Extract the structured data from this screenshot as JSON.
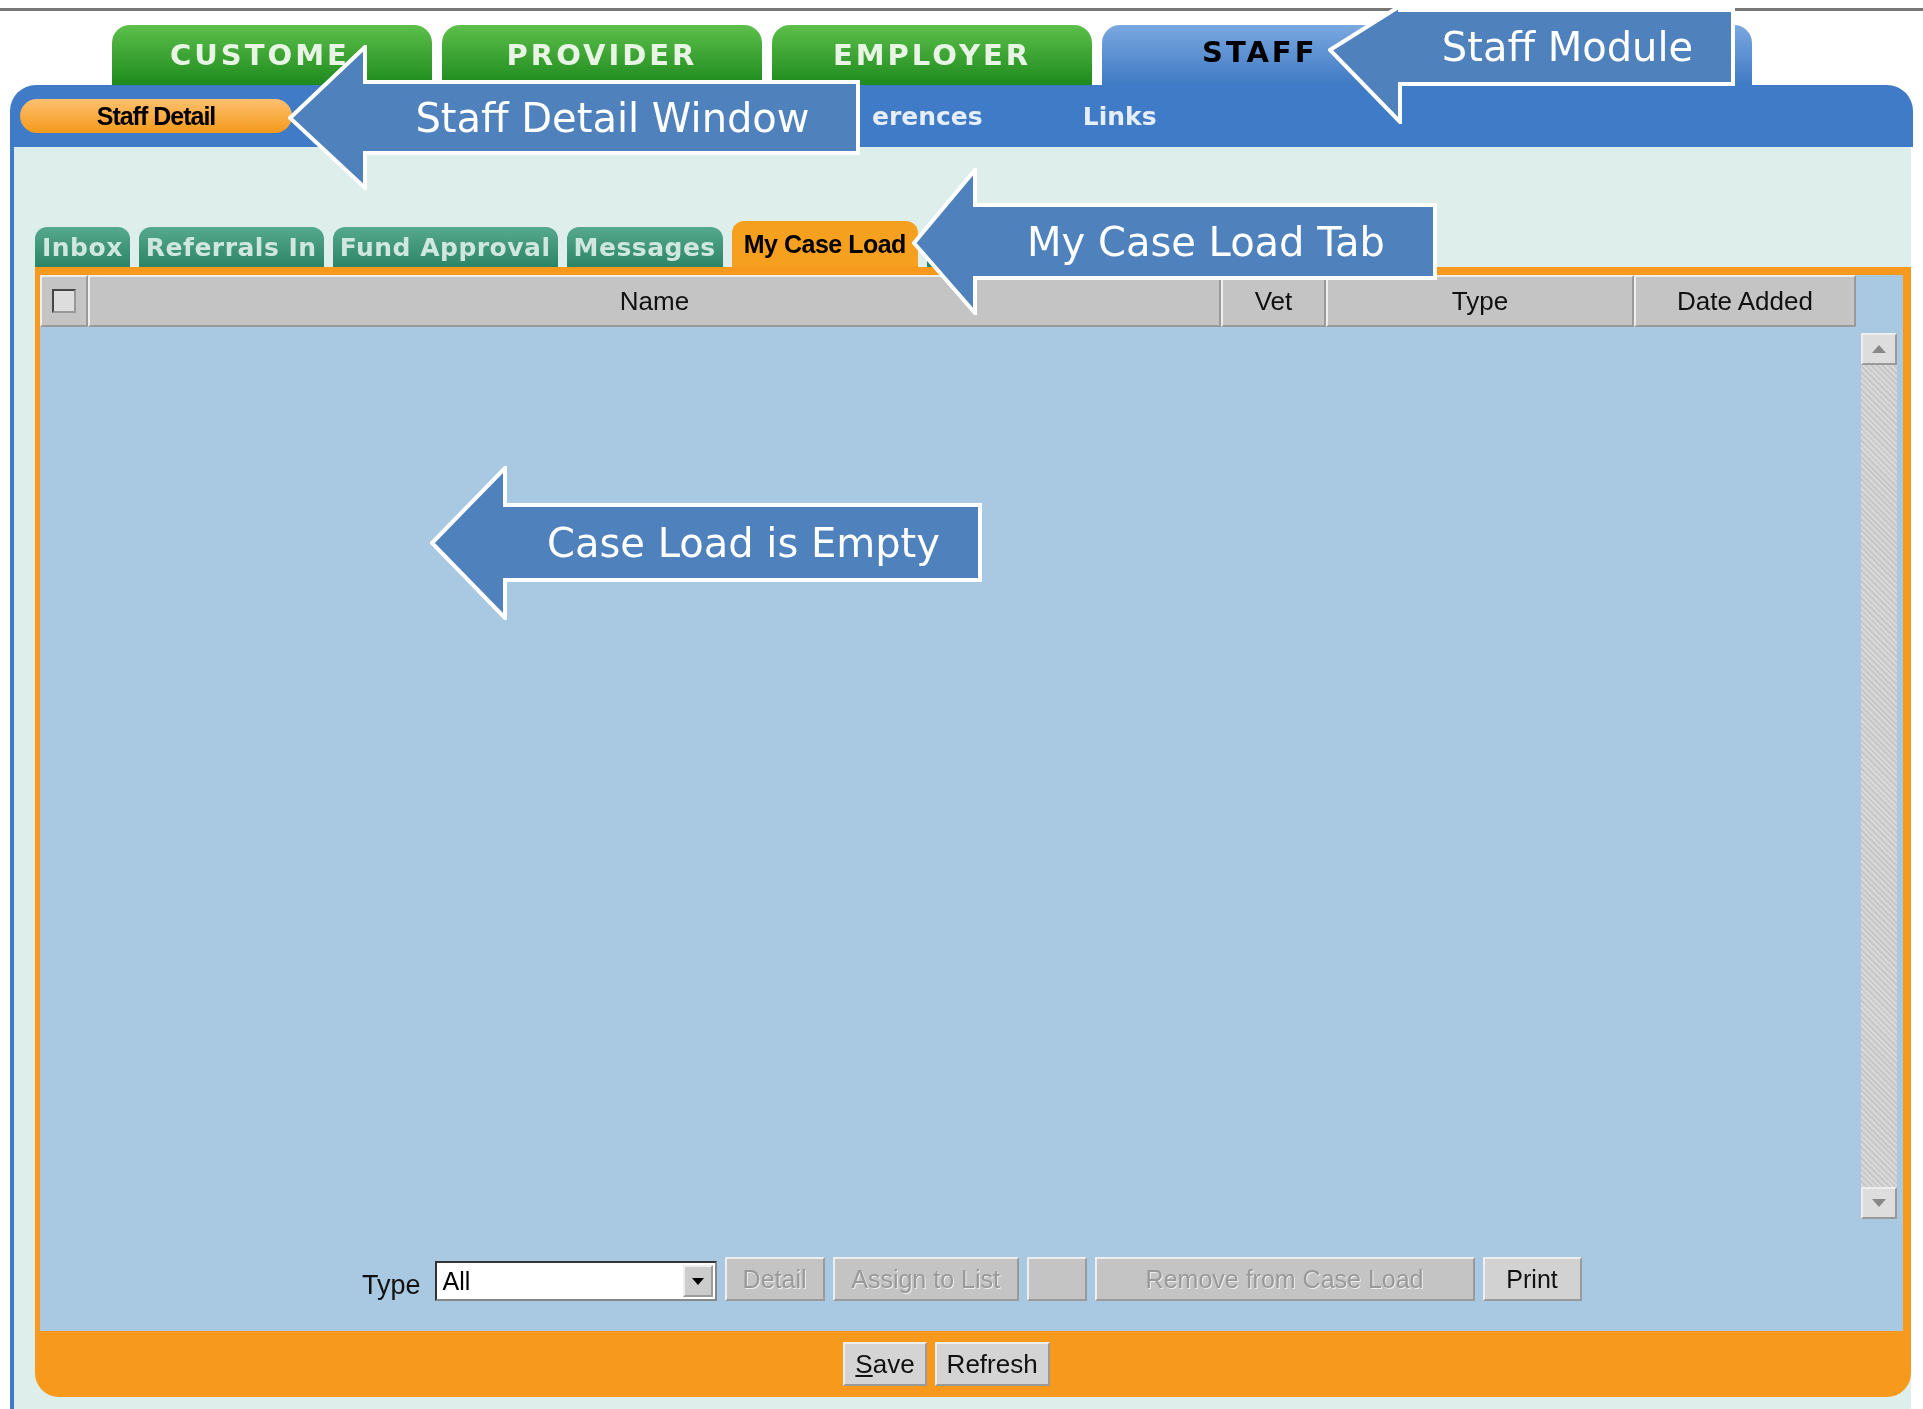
{
  "module_tabs": [
    {
      "label": "CUSTOME",
      "selected": false
    },
    {
      "label": "PROVIDER",
      "selected": false
    },
    {
      "label": "EMPLOYER",
      "selected": false
    },
    {
      "label": "STAFF",
      "selected": true
    }
  ],
  "sub_nav": [
    {
      "label": "Staff Detail",
      "selected": true
    },
    {
      "label": "erences",
      "selected": false
    },
    {
      "label": "Links",
      "selected": false
    }
  ],
  "tabs": [
    {
      "label": "Inbox",
      "selected": false
    },
    {
      "label": "Referrals In",
      "selected": false
    },
    {
      "label": "Fund Approval",
      "selected": false
    },
    {
      "label": "Messages",
      "selected": false
    },
    {
      "label": "My Case Load",
      "selected": true
    }
  ],
  "table": {
    "select_all_checked": false,
    "columns": [
      "Name",
      "Vet",
      "Type",
      "Date Added"
    ]
  },
  "filter": {
    "label": "Type",
    "value": "All"
  },
  "actions": [
    {
      "label": "Detail",
      "disabled": true
    },
    {
      "label": "Assign to List",
      "disabled": true
    },
    {
      "disabled": true
    },
    {
      "label": "Remove from Case Load",
      "disabled": true
    },
    {
      "label": "Print",
      "disabled": false
    }
  ],
  "footer_buttons": [
    {
      "label": "Save",
      "underline_first": true
    },
    {
      "label": "Refresh",
      "underline_first": false
    }
  ],
  "callouts": [
    {
      "text": "Staff Module"
    },
    {
      "text": "Staff Detail Window"
    },
    {
      "text": "My Case Load Tab"
    },
    {
      "text": "Case Load is Empty"
    }
  ]
}
